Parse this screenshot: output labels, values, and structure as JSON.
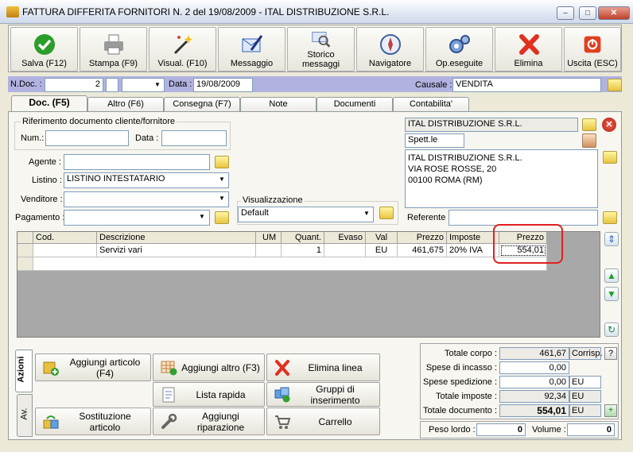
{
  "window": {
    "title": "FATTURA DIFFERITA FORNITORI N. 2  del 19/08/2009 - ITAL DISTRIBUZIONE S.R.L."
  },
  "toolbar": [
    {
      "label": "Salva (F12)",
      "icon": "checkmark-icon",
      "color": "#2a9d2a"
    },
    {
      "label": "Stampa (F9)",
      "icon": "printer-icon",
      "color": "#7a7a7a"
    },
    {
      "label": "Visual. (F10)",
      "icon": "magic-wand-icon",
      "color": "#d8a020"
    },
    {
      "label": "Messaggio",
      "icon": "pen-letter-icon",
      "color": "#3060b0"
    },
    {
      "label1": "Storico",
      "label2": "messaggi",
      "icon": "magnifier-letter-icon",
      "color": "#6080c0"
    },
    {
      "label": "Navigatore",
      "icon": "compass-icon",
      "color": "#c04040"
    },
    {
      "label": "Op.eseguite",
      "icon": "gears-icon",
      "color": "#4070c0"
    },
    {
      "label": "Elimina",
      "icon": "red-x-icon",
      "color": "#e03020"
    },
    {
      "label": "Uscita (ESC)",
      "icon": "exit-icon",
      "color": "#e04020"
    }
  ],
  "header": {
    "ndoc_label": "N.Doc. :",
    "ndoc_value": "2",
    "data_label": "Data :",
    "data_value": "19/08/2009",
    "causale_label": "Causale :",
    "causale_value": "VENDITA"
  },
  "tabs": [
    "Doc. (F5)",
    "Altro (F6)",
    "Consegna (F7)",
    "Note",
    "Documenti",
    "Contabilita'"
  ],
  "form": {
    "rif_title": "Riferimento documento cliente/fornitore",
    "num_label": "Num.:",
    "num_value": "",
    "data_label": "Data :",
    "data_value": "",
    "agente_label": "Agente :",
    "agente_value": "",
    "listino_label": "Listino :",
    "listino_value": "LISTINO INTESTATARIO",
    "venditore_label": "Venditore :",
    "venditore_value": "",
    "pagamento_label": "Pagamento :",
    "pagamento_value": "",
    "visual_label": "Visualizzazione",
    "visual_value": "Default",
    "referente_label": "Referente",
    "referente_value": ""
  },
  "cliente": {
    "name": "ITAL DISTRIBUZIONE S.R.L.",
    "spett": "Spett.le",
    "address": [
      "ITAL DISTRIBUZIONE S.R.L.",
      "VIA ROSE ROSSE, 20",
      "00100 ROMA (RM)"
    ]
  },
  "grid": {
    "columns": [
      "Cod.",
      "Descrizione",
      "UM",
      "Quant.",
      "Evaso",
      "Val",
      "Prezzo",
      "Imposte",
      "Prezzo"
    ],
    "rows": [
      {
        "cod": "",
        "descrizione": "Servizi vari",
        "um": "",
        "quant": "1",
        "evaso": "",
        "val": "EU",
        "prezzo": "461,675",
        "imposte": "20% IVA",
        "prezzo2": "554,01"
      }
    ]
  },
  "side_tabs": [
    "Azioni",
    "Av."
  ],
  "actions": [
    {
      "label": "Aggiungi articolo (F4)",
      "icon": "add-article-icon"
    },
    {
      "label": "Aggiungi altro (F3)",
      "icon": "add-grid-icon"
    },
    {
      "label": "Elimina linea",
      "icon": "delete-line-icon"
    },
    {
      "label": "Lista rapida",
      "icon": "quick-list-icon"
    },
    {
      "label": "Gruppi di inserimento",
      "icon": "insert-groups-icon"
    },
    {
      "label": "Sostituzione articolo",
      "icon": "replace-article-icon"
    },
    {
      "label": "Aggiungi riparazione",
      "icon": "repair-icon"
    },
    {
      "label": "Carrello",
      "icon": "cart-icon"
    }
  ],
  "totals": {
    "totale_corpo_label": "Totale corpo :",
    "totale_corpo": "461,67",
    "corrisp": "Corrisp.",
    "help": "?",
    "spese_incasso_label": "Spese di incasso :",
    "spese_incasso": "0,00",
    "spese_spedizione_label": "Spese spedizione :",
    "spese_spedizione": "0,00",
    "spese_spedizione_unit": "EU",
    "totale_imposte_label": "Totale imposte :",
    "totale_imposte": "92,34",
    "totale_imposte_unit": "EU",
    "totale_documento_label": "Totale documento :",
    "totale_documento": "554,01",
    "totale_documento_unit": "EU",
    "peso_label": "Peso lordo :",
    "peso": "0",
    "volume_label": "Volume :",
    "volume": "0"
  }
}
